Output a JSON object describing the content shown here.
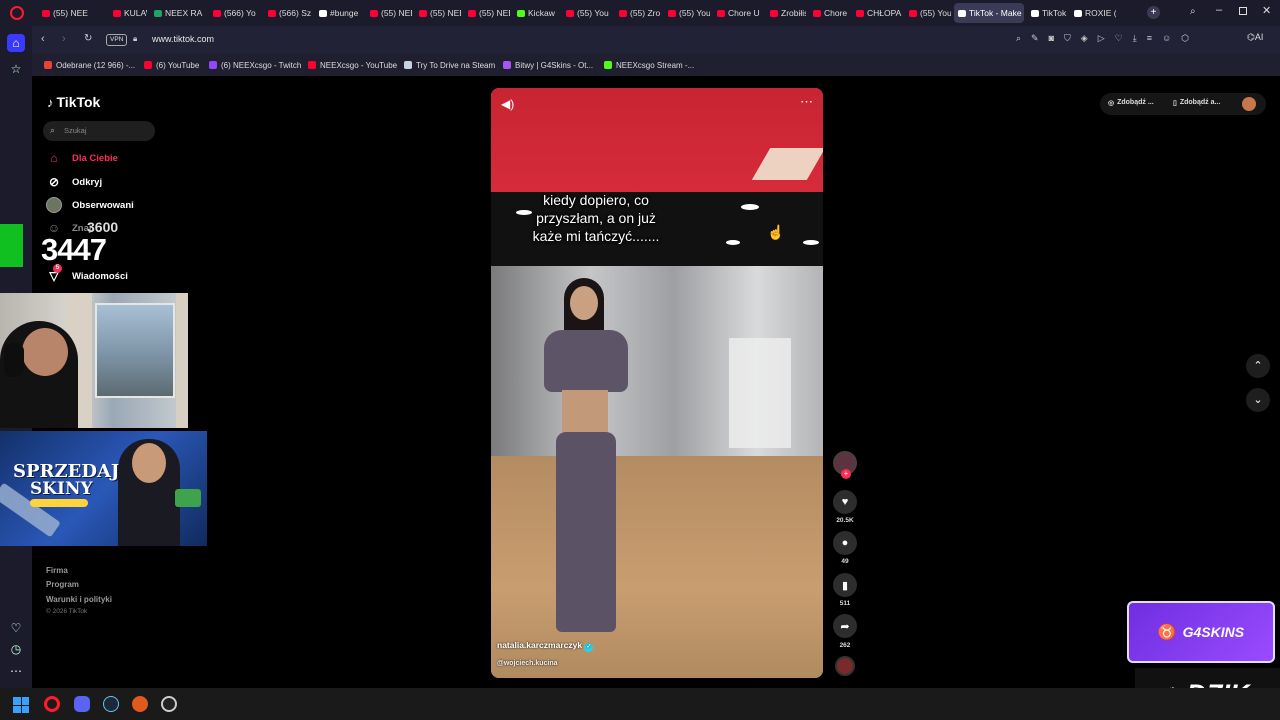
{
  "browser": {
    "tabs": [
      {
        "label": "(55) NEE",
        "color": "#ff0033"
      },
      {
        "label": "KULAW",
        "color": "#ff0033"
      },
      {
        "label": "NEEX RA",
        "color": "#1fa463"
      },
      {
        "label": "(566) Yo",
        "color": "#ff0033"
      },
      {
        "label": "(566) Sz",
        "color": "#ff0033"
      },
      {
        "label": "#bunge",
        "color": "#ffffff"
      },
      {
        "label": "(55) NEE",
        "color": "#ff0033"
      },
      {
        "label": "(55) NEE",
        "color": "#ff0033"
      },
      {
        "label": "(55) NEE",
        "color": "#ff0033"
      },
      {
        "label": "Kickaw",
        "color": "#53fc18"
      },
      {
        "label": "(55) You",
        "color": "#ff0033"
      },
      {
        "label": "(55) Zro",
        "color": "#ff0033"
      },
      {
        "label": "(55) You",
        "color": "#ff0033"
      },
      {
        "label": "Chore U",
        "color": "#ff0033"
      },
      {
        "label": "Zrobiłiś",
        "color": "#ff0033"
      },
      {
        "label": "Chore U",
        "color": "#ff0033"
      },
      {
        "label": "CHŁOPA",
        "color": "#ff0033"
      },
      {
        "label": "(55) You",
        "color": "#ff0033"
      },
      {
        "label": "TikTok - Make",
        "color": "#ffffff",
        "active": true
      },
      {
        "label": "TikTok",
        "color": "#ffffff"
      },
      {
        "label": "ROXIE (",
        "color": "#ffffff"
      }
    ],
    "url": "www.tiktok.com",
    "vpn_label": "VPN",
    "ai_label": "AI",
    "bookmarks": [
      {
        "label": "Odebrane (12 966) -...",
        "color": "#ea4335"
      },
      {
        "label": "(6) YouTube",
        "color": "#ff0033"
      },
      {
        "label": "(6) NEEXcsgo - Twitch",
        "color": "#9146ff"
      },
      {
        "label": "NEEXcsgo - YouTube",
        "color": "#ff0033"
      },
      {
        "label": "Try To Drive na Steam",
        "color": "#c7d5e0"
      },
      {
        "label": "Bitwy | G4Skins - Ot...",
        "color": "#a855f7"
      },
      {
        "label": "NEEXcsgo Stream -...",
        "color": "#53fc18"
      }
    ]
  },
  "tiktok": {
    "logo": "TikTok",
    "search_placeholder": "Szukaj",
    "nav": {
      "for_you": "Dla Ciebie",
      "explore": "Odkryj",
      "following": "Obserwowani",
      "friends": "Znaj",
      "messages": "Wiadomości",
      "messages_badge": "5"
    },
    "footer": {
      "company": "Firma",
      "program": "Program",
      "terms": "Warunki i polityki",
      "copyright": "© 2026 TikTok"
    },
    "top_right": {
      "get_coins": "Zdobądź ...",
      "get_app": "Zdobądź a..."
    },
    "video": {
      "caption": "kiedy dopiero, co przyszłam, a on już każe mi tańczyć.......",
      "author": "natalia.karczmarczyk",
      "sound_author": "@wojciech.kucina"
    },
    "counts": {
      "likes": "20.5K",
      "comments": "49",
      "saves": "511",
      "shares": "262"
    }
  },
  "stream_overlay": {
    "counter_target": "3600",
    "counter_value": "3447",
    "ad_line1": "SPRZEDAJ",
    "ad_line2": "SKINY",
    "ad_brand": "G4SKINS",
    "logo_right": "DZIK"
  }
}
